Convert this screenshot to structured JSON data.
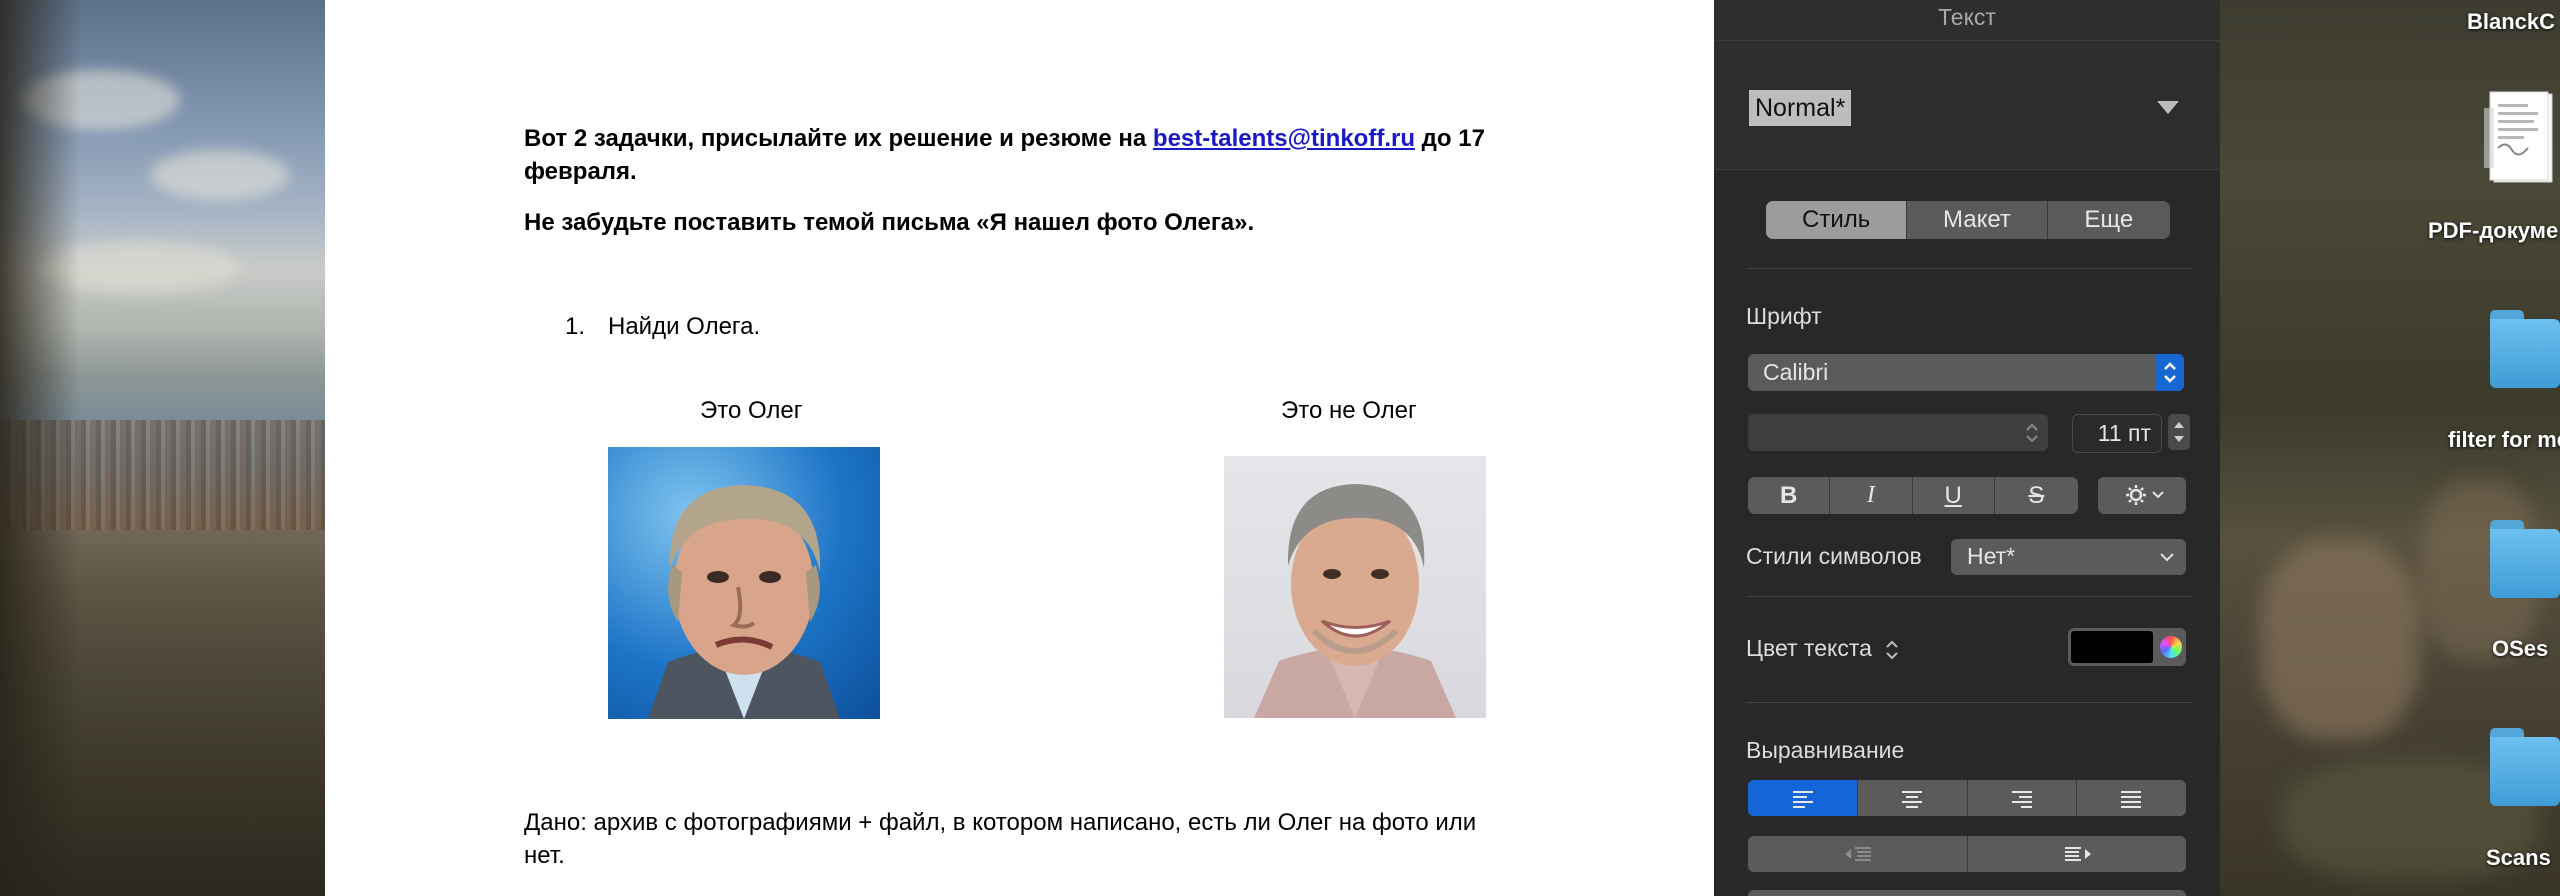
{
  "document": {
    "intro_text": "Вот 2 задачки, присылайте их решение и резюме на ",
    "email": "best-talents@tinkoff.ru",
    "intro_tail_1": " до 17",
    "intro_tail_2": "февраля.",
    "reminder": "Не забудьте поставить темой письма «Я нашел фото Олега».",
    "list_number": "1.",
    "list_item": "Найди Олега.",
    "caption_left": "Это Олег",
    "caption_right": "Это не Олег",
    "given_line1": "Дано: архив с фотографиями + файл, в котором написано, есть ли Олег на фото или",
    "given_line2": "нет."
  },
  "inspector": {
    "title": "Текст",
    "paragraph_style": "Normal*",
    "tabs": [
      {
        "label": "Стиль",
        "active": true
      },
      {
        "label": "Макет",
        "active": false
      },
      {
        "label": "Еще",
        "active": false
      }
    ],
    "font_section": "Шрифт",
    "font_family": "Calibri",
    "font_typeface": "",
    "font_size": "11 пт",
    "format_buttons": {
      "bold": "B",
      "italic": "I",
      "underline": "U",
      "strike": "S"
    },
    "char_styles_label": "Стили символов",
    "char_styles_value": "Нет*",
    "text_color_label": "Цвет текста",
    "text_color": "#000000",
    "alignment_section": "Выравнивание",
    "alignment_active": "left"
  },
  "desktop": {
    "items": [
      {
        "label": "BlanckC",
        "icon": "document-icon"
      },
      {
        "label": "PDF-докуме",
        "icon": "pdf-document-icon"
      },
      {
        "label": "filter for me",
        "icon": "folder-icon"
      },
      {
        "label": "OSes",
        "icon": "folder-icon"
      },
      {
        "label": "Scans",
        "icon": "folder-icon"
      }
    ]
  },
  "colors": {
    "panel_bg": "#282828",
    "accent_blue": "#1565d8",
    "link_blue": "#1a18c8",
    "folder_blue": "#4aa8e0"
  }
}
